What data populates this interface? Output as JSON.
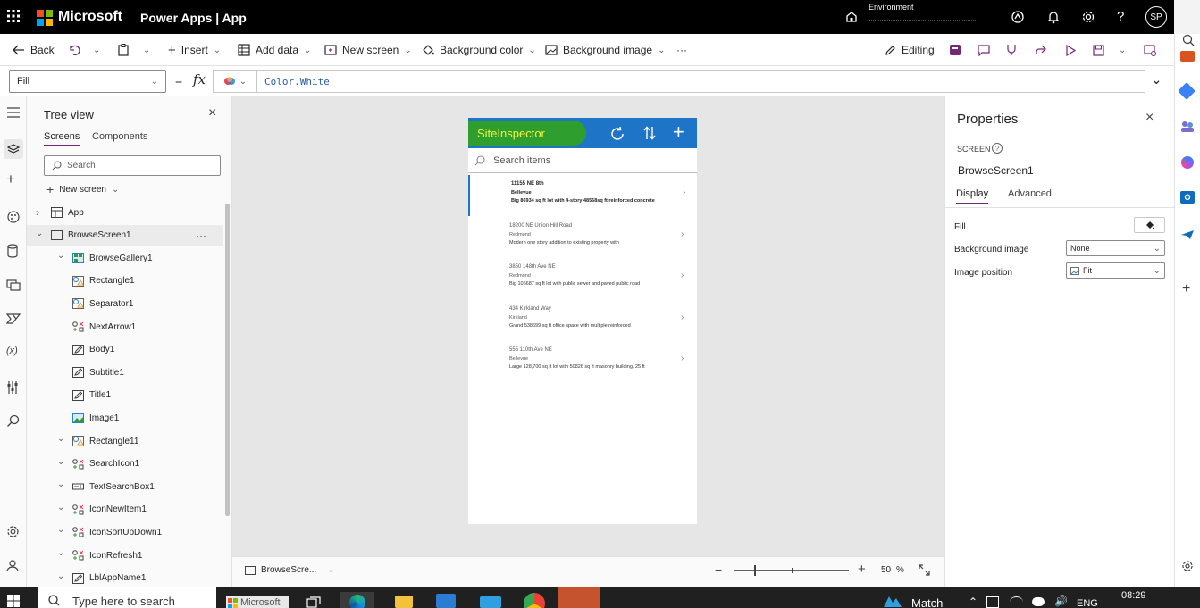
{
  "topbar": {
    "brand": "Microsoft",
    "app": "Power Apps  |  App",
    "environment_label": "Environment",
    "avatar": "SP",
    "icons": [
      "waffle-icon",
      "environment-icon",
      "copilot-icon",
      "bell-icon",
      "gear-icon",
      "help-icon"
    ]
  },
  "commandbar": {
    "back": "Back",
    "insert": "Insert",
    "add_data": "Add data",
    "new_screen": "New screen",
    "background_color": "Background color",
    "background_image": "Background image",
    "more": "···",
    "editing": "Editing"
  },
  "formulabar": {
    "property": "Fill",
    "equals": "=",
    "fx": "fx",
    "formula": "Color.White"
  },
  "treeview": {
    "title": "Tree view",
    "tabs": [
      "Screens",
      "Components"
    ],
    "search_placeholder": "Search",
    "new_screen": "New screen",
    "items": [
      {
        "label": "App",
        "indent": 0,
        "icon": "app"
      },
      {
        "label": "BrowseScreen1",
        "indent": 0,
        "icon": "screen",
        "selected": true,
        "more": "···"
      },
      {
        "label": "BrowseGallery1",
        "indent": 1,
        "icon": "gallery"
      },
      {
        "label": "Rectangle1",
        "indent": 2,
        "icon": "shape"
      },
      {
        "label": "Separator1",
        "indent": 2,
        "icon": "shape"
      },
      {
        "label": "NextArrow1",
        "indent": 2,
        "icon": "iconctl"
      },
      {
        "label": "Body1",
        "indent": 2,
        "icon": "label"
      },
      {
        "label": "Subtitle1",
        "indent": 2,
        "icon": "label"
      },
      {
        "label": "Title1",
        "indent": 2,
        "icon": "label"
      },
      {
        "label": "Image1",
        "indent": 2,
        "icon": "image"
      },
      {
        "label": "Rectangle11",
        "indent": 1,
        "icon": "shape"
      },
      {
        "label": "SearchIcon1",
        "indent": 1,
        "icon": "iconctl"
      },
      {
        "label": "TextSearchBox1",
        "indent": 1,
        "icon": "textinput"
      },
      {
        "label": "IconNewItem1",
        "indent": 1,
        "icon": "iconctl"
      },
      {
        "label": "IconSortUpDown1",
        "indent": 1,
        "icon": "iconctl"
      },
      {
        "label": "IconRefresh1",
        "indent": 1,
        "icon": "iconctl"
      },
      {
        "label": "LblAppName1",
        "indent": 1,
        "icon": "label"
      }
    ]
  },
  "app_preview": {
    "title": "SiteInspector",
    "search_placeholder": "Search items",
    "header_color": "#1e74c6",
    "title_highlight": "#2e9e2e",
    "title_color": "#f7f43b",
    "gallery": [
      {
        "title": "11155 NE 8th",
        "subtitle": "Bellevue",
        "body": "Big 86934 sq ft lot with 4-story 48568sq ft reinforced concrete",
        "selected": true
      },
      {
        "title": "18200 NE Union Hill Road",
        "subtitle": "Redmond",
        "body": "Modern one story addition to existing property with"
      },
      {
        "title": "3850 148th Ave NE",
        "subtitle": "Redmond",
        "body": "Big 106687 sq ft lot with public sewer and paved public road"
      },
      {
        "title": "434 Kirkland Way",
        "subtitle": "Kirkland",
        "body": "Grand 538699 sq ft office space with multiple reinforced"
      },
      {
        "title": "555 110th Ave NE",
        "subtitle": "Bellevue",
        "body": "Large 128,700 sq ft lot with 50826 sq ft masonry building. 25 ft"
      }
    ]
  },
  "canvasfooter": {
    "screen_name": "BrowseScre...",
    "zoom": "50",
    "zoom_unit": "%",
    "zoom_fraction": 0.5
  },
  "properties": {
    "title": "Properties",
    "type_label": "SCREEN",
    "name": "BrowseScreen1",
    "tabs": [
      "Display",
      "Advanced"
    ],
    "fill_label": "Fill",
    "background_image_label": "Background image",
    "background_image_value": "None",
    "image_position_label": "Image position",
    "image_position_value": "Fit"
  },
  "taskbar": {
    "search_placeholder": "Type here to search",
    "pinned_label": "Microsoft",
    "weather": "Match",
    "language": "ENG",
    "time": "08:29"
  },
  "colors": {
    "accent": "#742774",
    "topbar": "#000000",
    "canvas": "#e6e6e6",
    "tree_selected": "#ebebeb"
  }
}
